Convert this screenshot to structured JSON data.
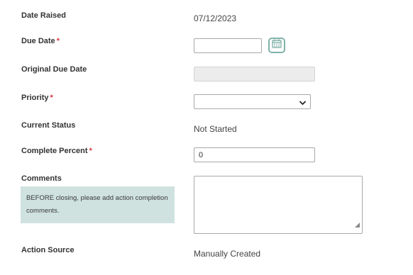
{
  "form": {
    "date_raised": {
      "label": "Date Raised",
      "value": "07/12/2023"
    },
    "due_date": {
      "label": "Due Date",
      "required_mark": "*",
      "value": "",
      "calendar_icon": "calendar-icon"
    },
    "original_due_date": {
      "label": "Original Due Date",
      "value": ""
    },
    "priority": {
      "label": "Priority",
      "required_mark": "*",
      "selected": "",
      "icon": "chevron-down-icon"
    },
    "current_status": {
      "label": "Current Status",
      "value": "Not Started"
    },
    "complete_percent": {
      "label": "Complete Percent",
      "required_mark": "*",
      "value": "0"
    },
    "comments": {
      "label": "Comments",
      "note": "BEFORE closing, please add action completion comments.",
      "value": ""
    },
    "action_source": {
      "label": "Action Source",
      "value": "Manually Created"
    }
  },
  "colors": {
    "required": "#d9363e",
    "note_background": "#cfe2df",
    "calendar_accent": "#7fb3a9",
    "disabled_field": "#ececec"
  }
}
